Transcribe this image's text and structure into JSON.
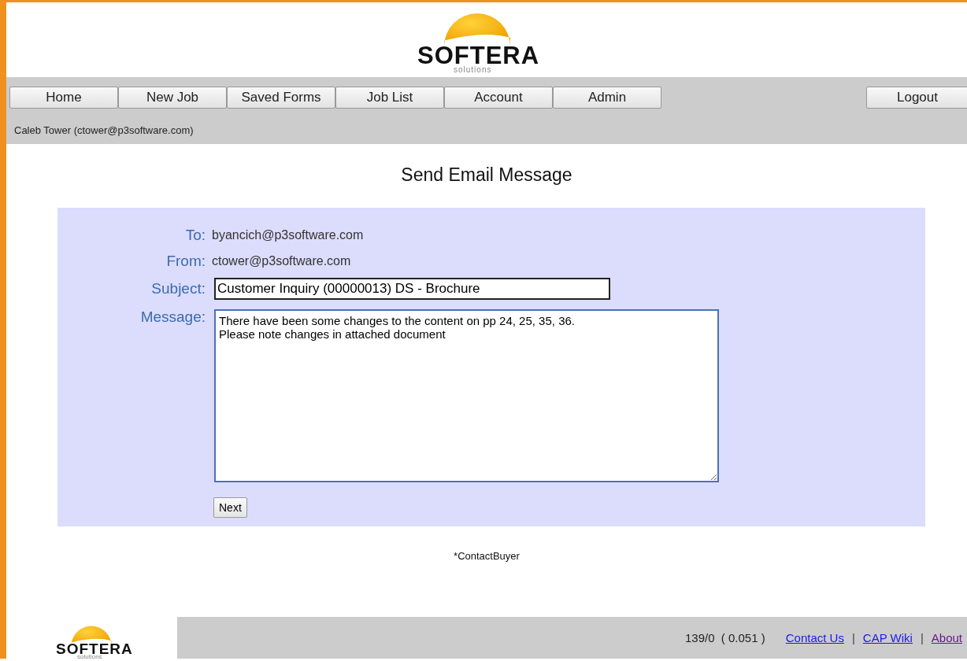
{
  "logo": {
    "name": "SOFTERA",
    "tagline": "solutions"
  },
  "nav": {
    "items": [
      {
        "label": "Home"
      },
      {
        "label": "New Job"
      },
      {
        "label": "Saved Forms"
      },
      {
        "label": "Job List"
      },
      {
        "label": "Account"
      },
      {
        "label": "Admin"
      }
    ],
    "logout": "Logout"
  },
  "user": "Caleb Tower (ctower@p3software.com)",
  "page_title": "Send Email Message",
  "form": {
    "to_label": "To:",
    "to": "byancich@p3software.com",
    "from_label": "From:",
    "from": "ctower@p3software.com",
    "subject_label": "Subject:",
    "subject": "Customer Inquiry (00000013) DS - Brochure",
    "message_label": "Message:",
    "message": "There have been some changes to the content on pp 24, 25, 35, 36.\nPlease note changes in attached document",
    "next": "Next"
  },
  "form_id": "*ContactBuyer",
  "footer": {
    "logo": {
      "name": "SOFTERA",
      "tagline": "solutions"
    },
    "stats": "139/0  ( 0.051 )",
    "separator": "|",
    "links": [
      {
        "label": "Contact Us",
        "visited": false
      },
      {
        "label": "CAP Wiki",
        "visited": false
      },
      {
        "label": "About",
        "visited": true
      }
    ]
  }
}
